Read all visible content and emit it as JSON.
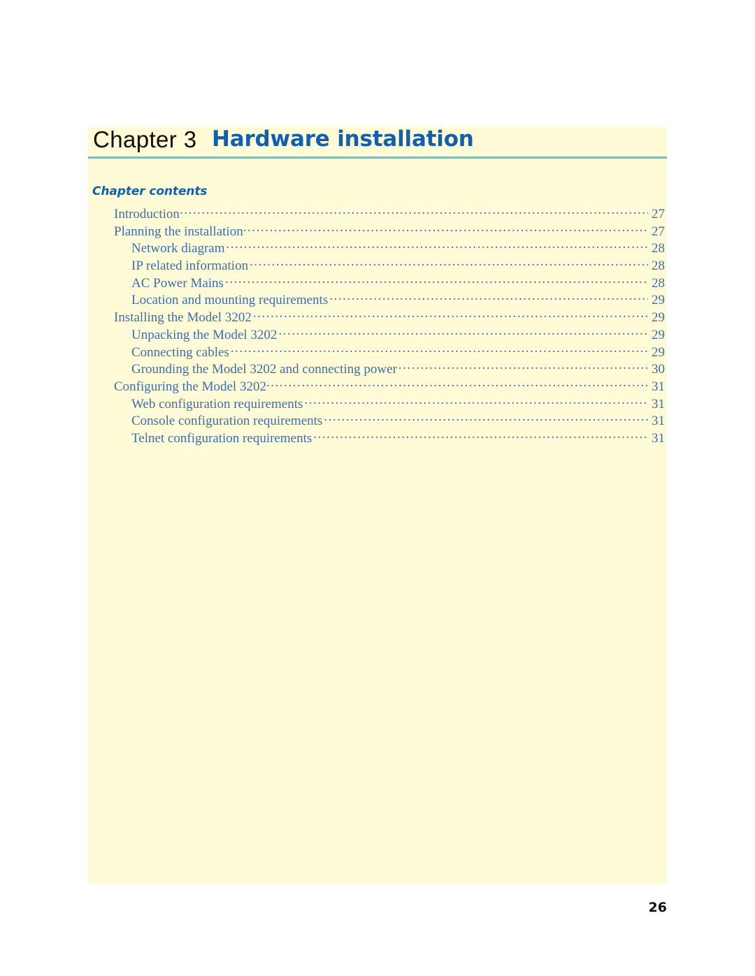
{
  "document": {
    "background_color": "#ffffff",
    "content_panel_color": "#fffbd6",
    "accent_blue": "#1160b0",
    "toc_blue": "#3a6fae",
    "rule_color": "#7fbcb3"
  },
  "header": {
    "chapter_label": "Chapter 3",
    "chapter_title": "Hardware installation"
  },
  "contents": {
    "heading": "Chapter contents",
    "entries": [
      {
        "label": "Introduction",
        "page": "27",
        "level": 1,
        "tight": true
      },
      {
        "label": "Planning the installation",
        "page": "27",
        "level": 1,
        "tight": true
      },
      {
        "label": "Network diagram",
        "page": "28",
        "level": 2,
        "tight": false
      },
      {
        "label": "IP related information",
        "page": "28",
        "level": 2,
        "tight": false
      },
      {
        "label": "AC Power Mains",
        "page": "28",
        "level": 2,
        "tight": false
      },
      {
        "label": "Location and mounting requirements",
        "page": "29",
        "level": 2,
        "tight": false
      },
      {
        "label": "Installing the Model 3202",
        "page": "29",
        "level": 1,
        "tight": false
      },
      {
        "label": "Unpacking the Model 3202",
        "page": "29",
        "level": 2,
        "tight": false
      },
      {
        "label": "Connecting cables",
        "page": "29",
        "level": 2,
        "tight": false
      },
      {
        "label": "Grounding the Model 3202 and connecting power",
        "page": "30",
        "level": 2,
        "tight": false
      },
      {
        "label": "Configuring the Model 3202",
        "page": "31",
        "level": 1,
        "tight": true
      },
      {
        "label": "Web configuration requirements",
        "page": "31",
        "level": 2,
        "tight": false
      },
      {
        "label": "Console configuration requirements",
        "page": "31",
        "level": 2,
        "tight": false
      },
      {
        "label": "Telnet configuration requirements",
        "page": "31",
        "level": 2,
        "tight": false
      }
    ]
  },
  "footer": {
    "page_number": "26"
  }
}
